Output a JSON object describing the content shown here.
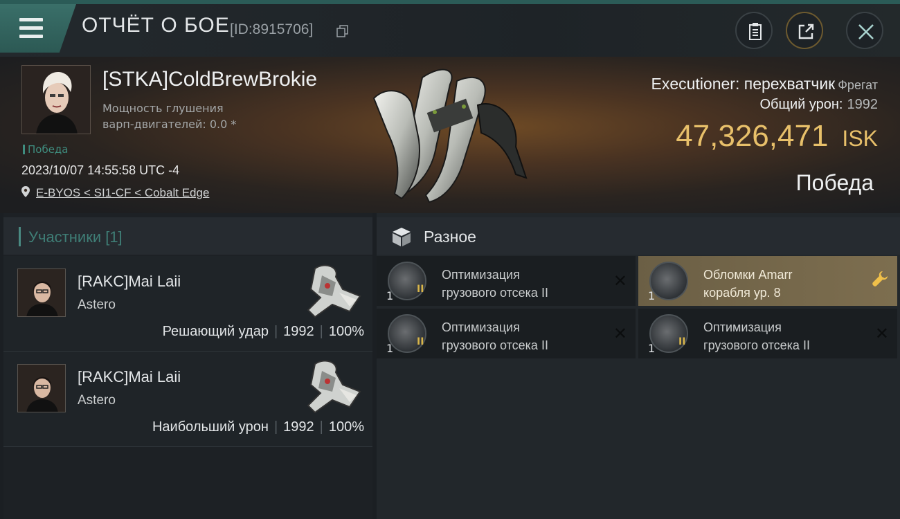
{
  "header": {
    "title": "ОТЧЁТ О БОЕ",
    "battle_id": "[ID:8915706]",
    "icons": [
      "menu-icon",
      "copy-icon",
      "clipboard-icon",
      "share-icon",
      "close-icon"
    ]
  },
  "victim": {
    "name": "[STKA]ColdBrewBrokie",
    "warp_label_1": "Мощность глушения",
    "warp_label_2": "варп-двигателей: 0.0 *",
    "status_tag": "Победа",
    "datetime": "2023/10/07 14:55:58 UTC -4",
    "location": "E-BYOS < SI1-CF < Cobalt Edge"
  },
  "ship": {
    "name": "Executioner: перехватчик",
    "class": "Фрегат",
    "damage_label": "Общий урон:",
    "damage_value": "1992",
    "isk_value": "47,326,471",
    "isk_currency": "ISK",
    "result": "Победа"
  },
  "participants": {
    "header": "Участники [1]",
    "rows": [
      {
        "name": "[RAKC]Mai Laii",
        "ship": "Astero",
        "role": "Решающий удар",
        "damage": "1992",
        "percent": "100%"
      },
      {
        "name": "[RAKC]Mai Laii",
        "ship": "Astero",
        "role": "Наибольший урон",
        "damage": "1992",
        "percent": "100%"
      }
    ]
  },
  "misc": {
    "header": "Разное",
    "items": [
      {
        "qty": "1",
        "meta": "II",
        "line1": "Оптимизация",
        "line2": "грузового отсека II",
        "action": "close-icon",
        "highlight": false
      },
      {
        "qty": "1",
        "meta": "",
        "line1": "Обломки Amarr",
        "line2": "корабля ур. 8",
        "action": "wrench-icon",
        "highlight": true
      },
      {
        "qty": "1",
        "meta": "II",
        "line1": "Оптимизация",
        "line2": "грузового отсека II",
        "action": "close-icon",
        "highlight": false
      },
      {
        "qty": "1",
        "meta": "II",
        "line1": "Оптимизация",
        "line2": "грузового отсека II",
        "action": "close-icon",
        "highlight": false
      }
    ],
    "x_glyph": "✕"
  },
  "colors": {
    "accent_teal": "#3f8d7f",
    "isk_gold": "#e8c06a",
    "highlight_item": "#7d6e4f"
  }
}
